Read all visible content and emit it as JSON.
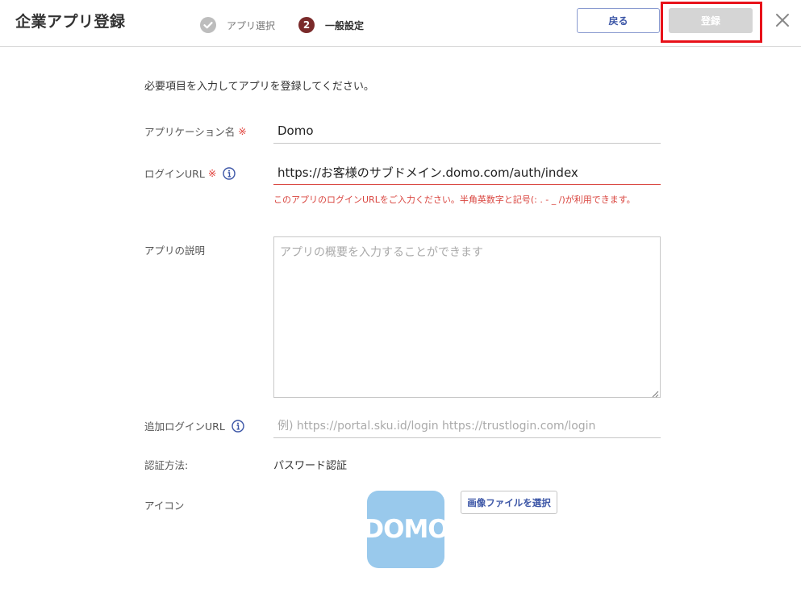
{
  "header": {
    "title": "企業アプリ登録",
    "steps": [
      {
        "number": "",
        "label": "アプリ選択",
        "state": "done"
      },
      {
        "number": "2",
        "label": "一般設定",
        "state": "active"
      }
    ],
    "back_label": "戻る",
    "register_label": "登録",
    "register_disabled": true
  },
  "form": {
    "intro": "必要項目を入力してアプリを登録してください。",
    "required_mark": "※",
    "app_name": {
      "label": "アプリケーション名",
      "value": "Domo"
    },
    "login_url": {
      "label": "ログインURL",
      "value": "https://お客様のサブドメイン.domo.com/auth/index",
      "error": "このアプリのログインURLをご入力ください。半角英数字と記号(: . - _ /)が利用できます。"
    },
    "description": {
      "label": "アプリの説明",
      "placeholder": "アプリの概要を入力することができます"
    },
    "additional_login_url": {
      "label": "追加ログインURL",
      "placeholder": "例) https://portal.sku.id/login https://trustlogin.com/login"
    },
    "auth_method": {
      "label": "認証方法:",
      "value": "パスワード認証"
    },
    "icon": {
      "label": "アイコン",
      "logo_text": "DOMO",
      "select_file_label": "画像ファイルを選択"
    }
  },
  "colors": {
    "accent": "#3b55a6",
    "error": "#d9443e",
    "step_active": "#7a2a2a",
    "highlight": "#e8121a",
    "logo_bg": "#99c9ec"
  },
  "icons": [
    "check-circle-icon",
    "info-icon",
    "close-icon",
    "resize-grip-icon"
  ]
}
